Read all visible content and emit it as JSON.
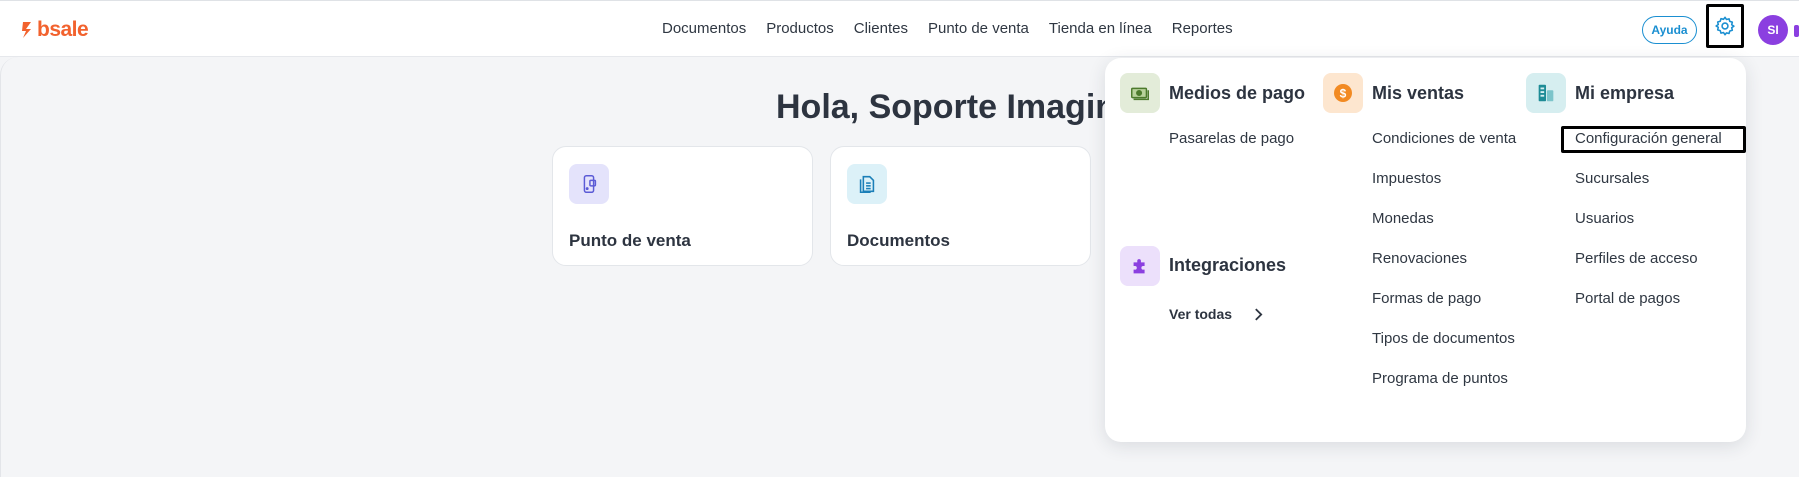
{
  "brand": {
    "name": "bsale",
    "color": "#f2622e"
  },
  "nav": {
    "items": [
      {
        "label": "Documentos"
      },
      {
        "label": "Productos"
      },
      {
        "label": "Clientes"
      },
      {
        "label": "Punto de venta"
      },
      {
        "label": "Tienda en línea"
      },
      {
        "label": "Reportes"
      }
    ]
  },
  "header": {
    "help_label": "Ayuda",
    "settings_icon": "gear-icon",
    "avatar_initials": "SI"
  },
  "main": {
    "greeting": "Hola, Soporte Imagin",
    "cards": [
      {
        "label": "Punto de venta",
        "icon": "pos-terminal-icon"
      },
      {
        "label": "Documentos",
        "icon": "document-icon"
      }
    ]
  },
  "settings_menu": {
    "medios": {
      "title": "Medios de pago",
      "icon": "cash-icon",
      "links": [
        "Pasarelas de pago"
      ]
    },
    "integraciones": {
      "title": "Integraciones",
      "icon": "puzzle-icon",
      "see_all": "Ver todas"
    },
    "ventas": {
      "title": "Mis ventas",
      "icon": "dollar-coin-icon",
      "links": [
        "Condiciones de venta",
        "Impuestos",
        "Monedas",
        "Renovaciones",
        "Formas de pago",
        "Tipos de documentos",
        "Programa de puntos"
      ]
    },
    "empresa": {
      "title": "Mi empresa",
      "icon": "building-icon",
      "links": [
        "Configuración general",
        "Sucursales",
        "Usuarios",
        "Perfiles de acceso",
        "Portal de pagos"
      ]
    }
  },
  "colors": {
    "accent": "#1b8fd1",
    "avatar": "#8b3fe0",
    "medios_bg": "#e3ecd9",
    "ventas_bg": "#fde6cf",
    "empresa_bg": "#d6eef0",
    "integraciones_bg": "#ece0fb"
  }
}
